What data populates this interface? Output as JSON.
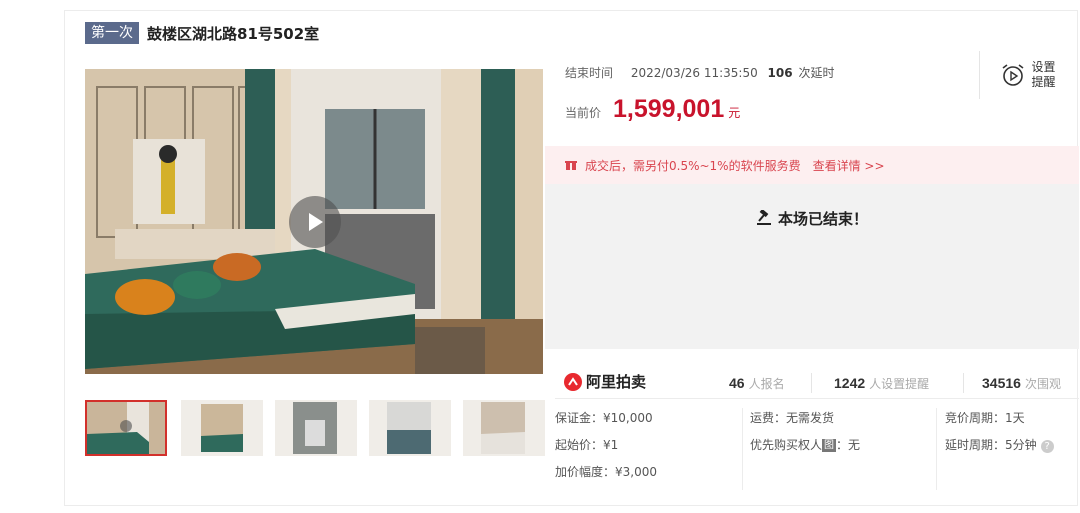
{
  "lot": {
    "round_tag": "第一次",
    "title": "鼓楼区湖北路81号502室"
  },
  "gallery": {
    "play_icon": "play-icon",
    "thumbs": [
      "thumb-1",
      "thumb-2",
      "thumb-3",
      "thumb-4",
      "thumb-5"
    ]
  },
  "auction": {
    "end_label": "结束时间",
    "end_time": "2022/03/26 11:35:50",
    "delay_count": "106",
    "delay_unit": "次延时",
    "price_label": "当前价",
    "price": "1,599,001",
    "price_unit": "元",
    "remind_label": "设置提醒",
    "fee_text": "成交后，需另付0.5%~1%的软件服务费",
    "fee_link": "查看详情 >>",
    "ended_text": "本场已结束！"
  },
  "stats": {
    "brand": "阿里拍卖",
    "signups": "46",
    "signups_unit": "人报名",
    "reminders": "1242",
    "reminders_unit": "人设置提醒",
    "views": "34516",
    "views_unit": "次围观"
  },
  "info": {
    "deposit": "保证金：¥10,000",
    "start_price": "起始价：¥1",
    "increment": "加价幅度：¥3,000",
    "shipping": "运费：无需发货",
    "priority_label": "优先购买权人",
    "priority_tag": "图",
    "priority_value": "：无",
    "cycle": "竞价周期：1天",
    "delay_cycle": "延时周期：5分钟"
  },
  "colors": {
    "price": "#c8132c",
    "tag_bg": "#5b6a8c",
    "fee_bg": "#fdeff0",
    "fee_text": "#d9454f",
    "ended_bg": "#f2f2f2"
  }
}
